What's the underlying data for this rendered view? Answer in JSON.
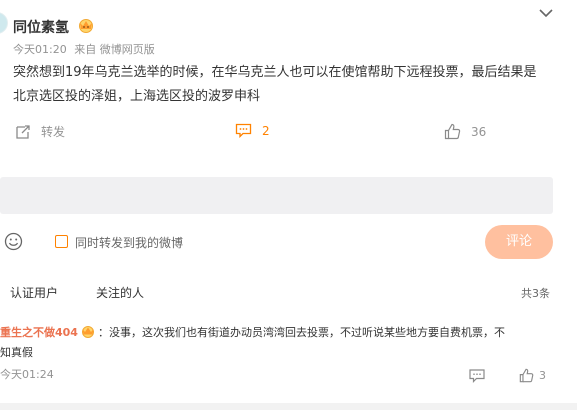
{
  "post": {
    "username": "同位素氢",
    "time": "今天01:20",
    "source": "来自 微博网页版",
    "content": "突然想到19年乌克兰选举的时候，在华乌克兰人也可以在使馆帮助下远程投票，最后结果是北京选区投的泽姐，上海选区投的波罗申科",
    "repost_label": "转发",
    "comment_count": "2",
    "like_count": "36"
  },
  "composer": {
    "checkbox_label": "同时转发到我的微博",
    "submit_label": "评论"
  },
  "filters": {
    "tab1": "认证用户",
    "tab2": "关注的人",
    "total": "共3条"
  },
  "comment": {
    "user": "重生之不做404",
    "text_line1": "：没事，这次我们也有街道办动员湾湾回去投票，不过听说某些地方要自费机票，不",
    "text_line2": "知真假",
    "time": "今天01:24",
    "like_count": "3"
  },
  "colors": {
    "accent": "#ff8200",
    "username_comment": "#eb7350",
    "submit_bg": "#ffc09f"
  },
  "icons": [
    "crown-icon",
    "chevron-down-icon",
    "repost-icon",
    "comment-icon",
    "like-icon",
    "emoji-icon",
    "reply-icon"
  ]
}
